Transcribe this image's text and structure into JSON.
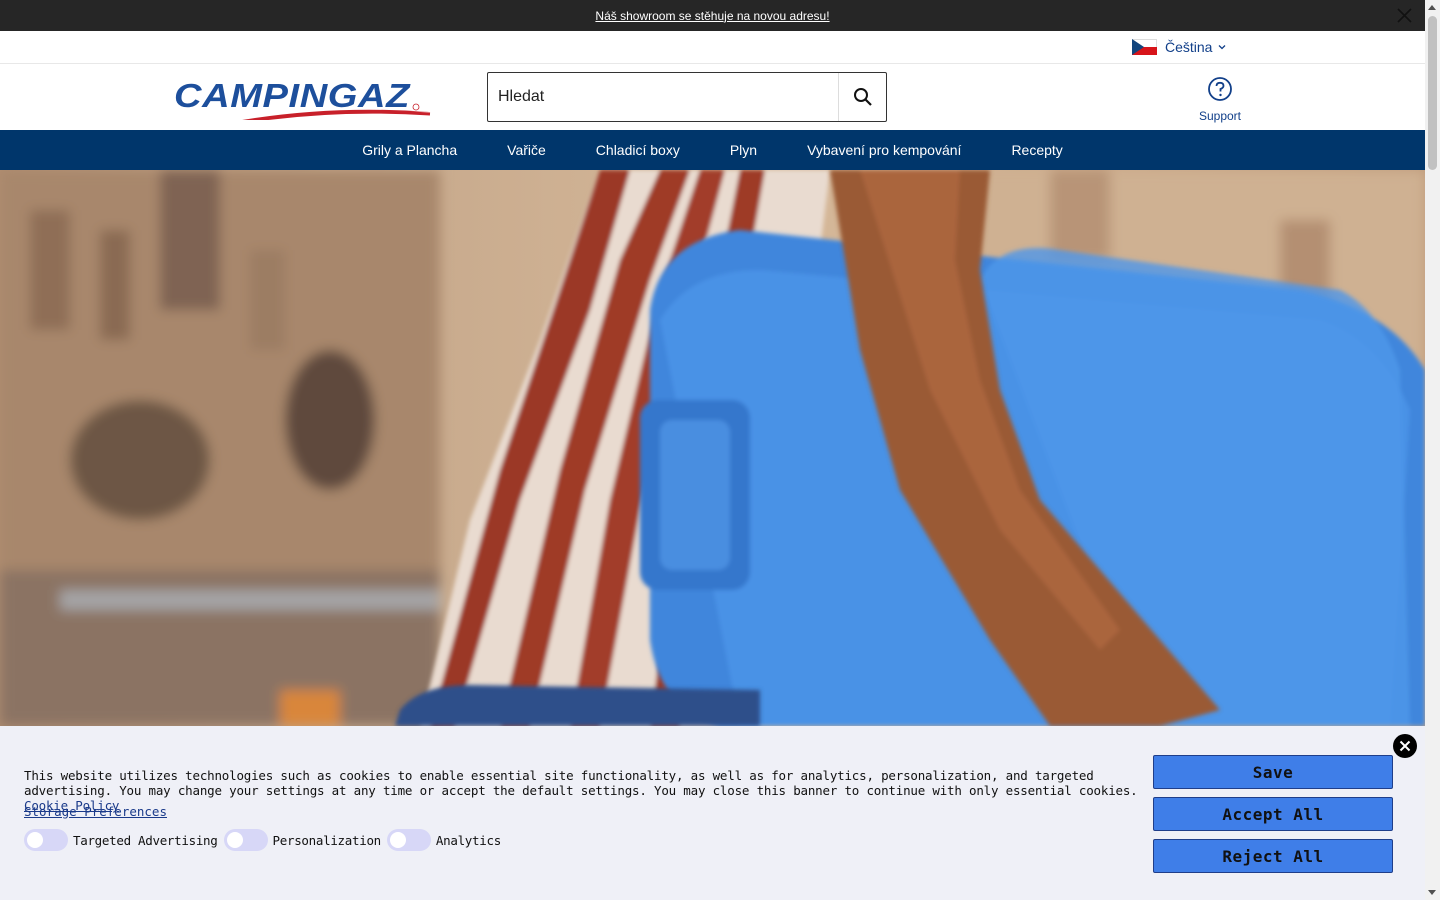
{
  "announcement": {
    "text": "Náš showroom se stěhuje na novou adresu!"
  },
  "language": {
    "label": "Čeština"
  },
  "header": {
    "logo_text": "CAMPINGAZ",
    "search_placeholder": "Hledat",
    "support_label": "Support"
  },
  "nav": {
    "items": [
      "Grily a Plancha",
      "Vařiče",
      "Chladicí boxy",
      "Plyn",
      "Vybavení pro kempování",
      "Recepty"
    ]
  },
  "cookie": {
    "text": "This website utilizes technologies such as cookies to enable essential site functionality, as well as for analytics, personalization, and targeted advertising. You may change your settings at any time or accept the default settings. You may close this banner to continue with only essential cookies.",
    "policy_link": "Cookie Policy",
    "storage_prefs": "Storage Preferences",
    "toggles": [
      "Targeted Advertising",
      "Personalization",
      "Analytics"
    ],
    "buttons": {
      "save": "Save",
      "accept": "Accept All",
      "reject": "Reject All"
    }
  }
}
